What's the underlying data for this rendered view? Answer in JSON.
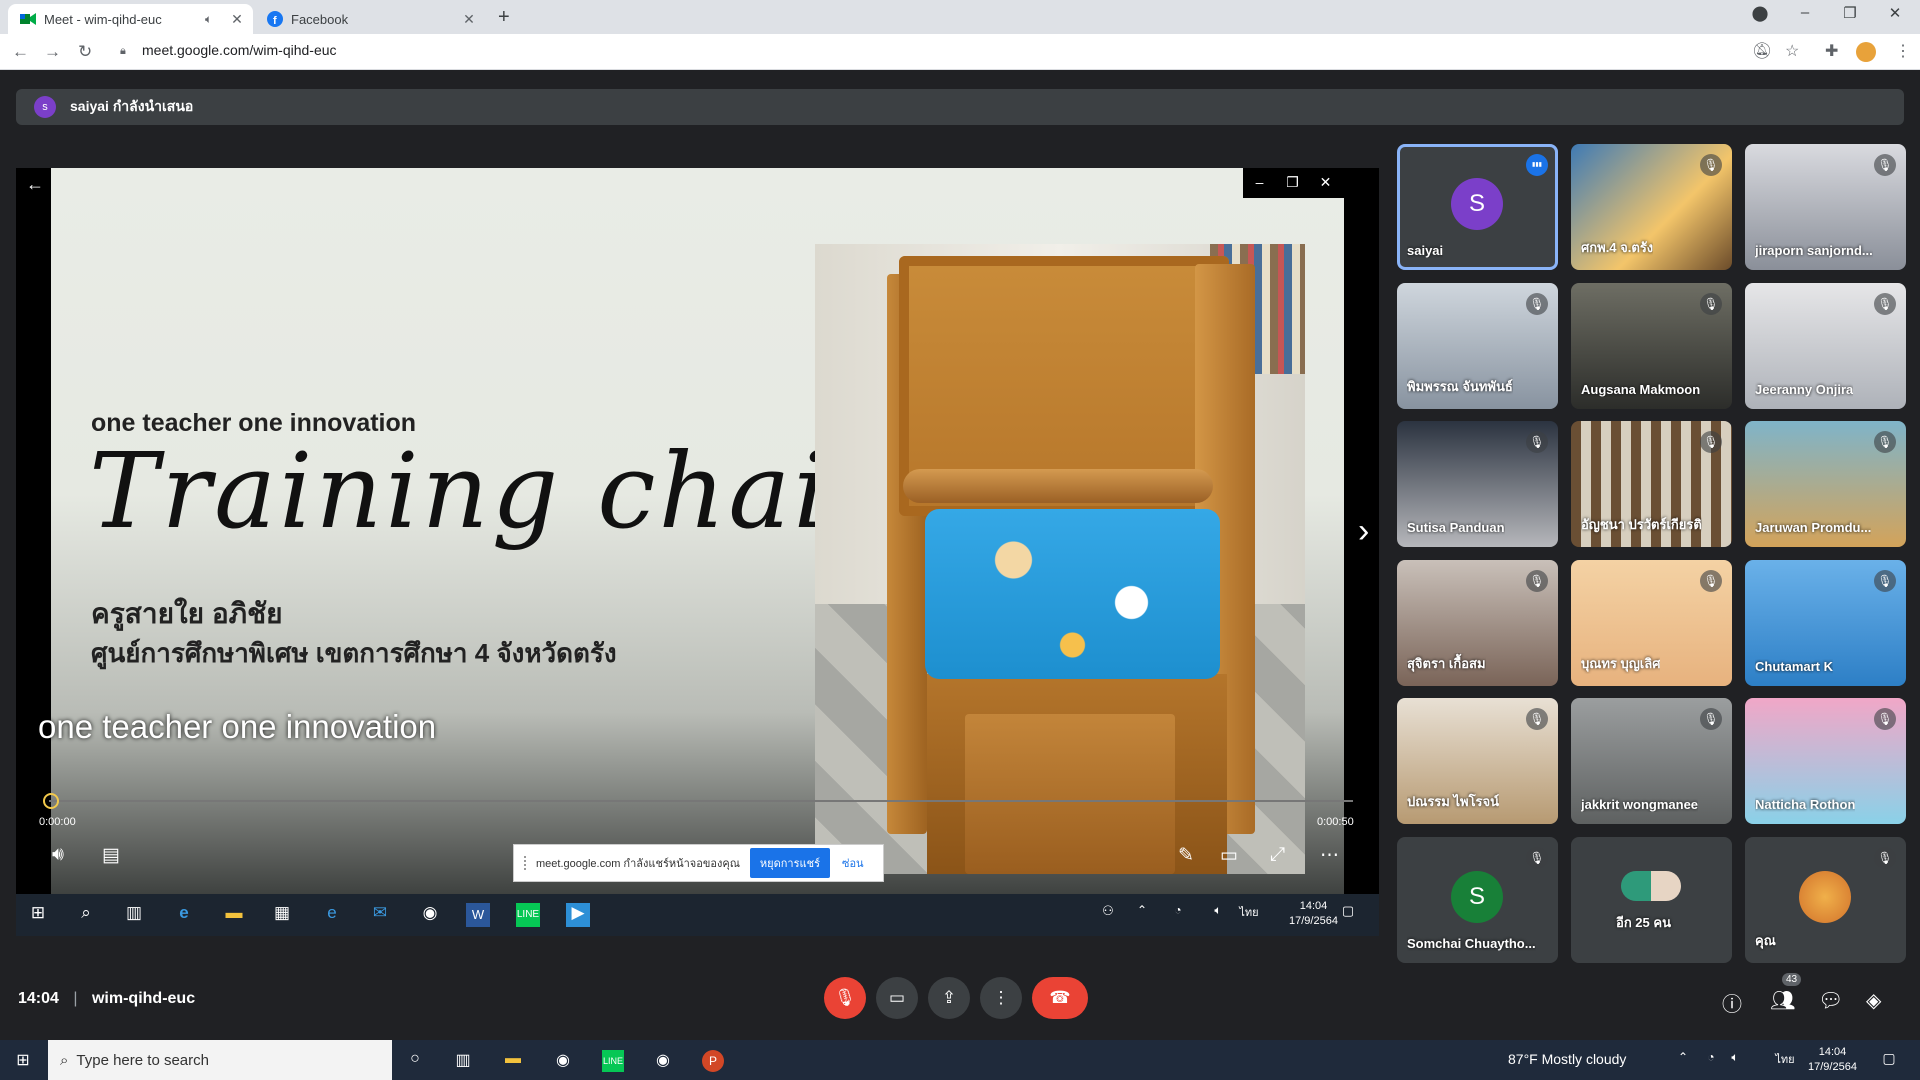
{
  "browser": {
    "tabs": [
      {
        "title": "Meet - wim-qihd-euc"
      },
      {
        "title": "Facebook"
      }
    ],
    "url": "meet.google.com/wim-qihd-euc"
  },
  "presenting_bar": {
    "avatar_letter": "s",
    "text": "saiyai กำลังนำเสนอ"
  },
  "slide": {
    "small_title": "one teacher one innovation",
    "big_title": "Training chair",
    "author": "ครูสายใย อภิชัย",
    "organization": "ศูนย์การศึกษาพิเศษ เขตการศึกษา 4 จังหวัดตรัง",
    "caption": "one teacher one innovation",
    "time_elapsed": "0:00:00",
    "time_total": "0:00:50"
  },
  "share_notice": {
    "text": "meet.google.com กำลังแชร์หน้าจอของคุณ",
    "stop_label": "หยุดการแชร์",
    "hide_label": "ซ่อน"
  },
  "remote_taskbar": {
    "time": "14:04",
    "date": "17/9/2564",
    "lang": "ไทย"
  },
  "participants": [
    {
      "name": "saiyai",
      "avatar_letter": "S",
      "avatar_color": "#7b3fc9",
      "speaking": true
    },
    {
      "name": "ศกพ.4 จ.ตรัง"
    },
    {
      "name": "jiraporn sanjornd..."
    },
    {
      "name": "พิมพรรณ จันทพันธ์"
    },
    {
      "name": "Augsana Makmoon"
    },
    {
      "name": "Jeeranny Onjira"
    },
    {
      "name": "Sutisa Panduan"
    },
    {
      "name": "อัญชนา ปรวัตร์เกียรติ"
    },
    {
      "name": "Jaruwan Promdu..."
    },
    {
      "name": "สุจิตรา เกื้อสม"
    },
    {
      "name": "บุณทร บุญเลิศ"
    },
    {
      "name": "Chutamart K"
    },
    {
      "name": "ปณรรม ไพโรจน์"
    },
    {
      "name": "jakkrit wongmanee"
    },
    {
      "name": "Natticha Rothon"
    },
    {
      "name": "Somchai Chuaytho...",
      "avatar_letter": "S",
      "avatar_color": "#188038"
    },
    {
      "name": "อีก 25 คน"
    },
    {
      "name": "คุณ"
    }
  ],
  "meeting_bar": {
    "time": "14:04",
    "code": "wim-qihd-euc",
    "participant_count": "43"
  },
  "windows_taskbar": {
    "search_placeholder": "Type here to search",
    "weather": "87°F  Mostly cloudy",
    "lang": "ไทย",
    "time": "14:04",
    "date": "17/9/2564"
  }
}
